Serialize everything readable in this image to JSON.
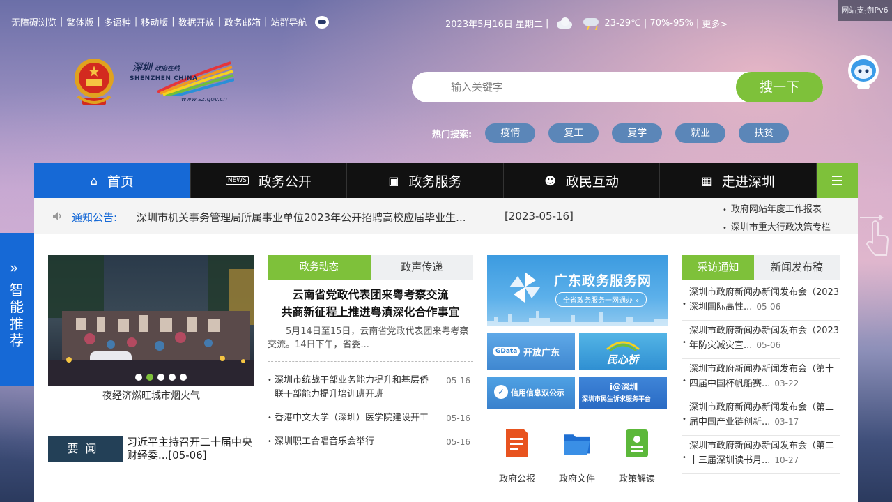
{
  "topbar": {
    "links": [
      "无障碍浏览",
      "繁体版",
      "多语种",
      "移动版",
      "数据开放",
      "政务邮箱",
      "站群导航"
    ],
    "date": "2023年5月16日 星期二",
    "weather": "23-29℃ | 70%-95%",
    "more": "更多>",
    "ipv6": "网站支持IPv6"
  },
  "logo": {
    "cn": "深圳",
    "cn_small": "政府在线",
    "en": "SHENZHEN CHINA",
    "url": "www.sz.gov.cn"
  },
  "search": {
    "placeholder": "输入关键字",
    "button": "搜一下",
    "hot_label": "热门搜索:",
    "hot_terms": [
      "疫情",
      "复工",
      "复学",
      "就业",
      "扶贫"
    ]
  },
  "nav": {
    "items": [
      "首页",
      "政务公开",
      "政务服务",
      "政民互动",
      "走进深圳"
    ]
  },
  "notice": {
    "label": "通知公告:",
    "text": "深圳市机关事务管理局所属事业单位2023年公开招聘高校应届毕业生...",
    "date": "[2023-05-16]",
    "quick_links": [
      "政府网站年度工作报表",
      "深圳市重大行政决策专栏"
    ]
  },
  "side": {
    "recommend": "智能推荐"
  },
  "carousel": {
    "caption": "夜经济燃旺城市烟火气",
    "active_index": 1
  },
  "important": {
    "tag": "要闻",
    "text": "习近平主持召开二十届中央财经委...[05-06]"
  },
  "news": {
    "tabs": [
      "政务动态",
      "政声传递"
    ],
    "headline_line1": "云南省党政代表团来粤考察交流",
    "headline_line2": "共商新征程上推进粤滇深化合作事宜",
    "summary": "5月14日至15日，云南省党政代表团来粤考察交流。14日下午，省委...",
    "items": [
      {
        "title": "深圳市统战干部业务能力提升和基层侨联干部能力提升培训班开班",
        "date": "05-16"
      },
      {
        "title": "香港中文大学（深圳）医学院建设开工",
        "date": "05-16"
      },
      {
        "title": "深圳职工合唱音乐会举行",
        "date": "05-16"
      }
    ]
  },
  "services": {
    "banner_title": "广东政务服务网",
    "banner_sub": "全省政务服务一网通办 »",
    "tiles": [
      "开放广东",
      "民心桥",
      "信用信息双公示",
      "深圳市民生诉求服务平台"
    ],
    "tile4_top": "i@深圳",
    "tile1_badge": "GData",
    "icons": [
      "政府公报",
      "政府文件",
      "政策解读"
    ]
  },
  "press": {
    "tabs": [
      "采访通知",
      "新闻发布稿"
    ],
    "items": [
      {
        "title": "深圳市政府新闻办新闻发布会（2023深圳国际高性...",
        "date": "05-06"
      },
      {
        "title": "深圳市政府新闻办新闻发布会（2023年防灾减灾宣...",
        "date": "05-06"
      },
      {
        "title": "深圳市政府新闻办新闻发布会（第十四届中国杯帆船赛...",
        "date": "03-22"
      },
      {
        "title": "深圳市政府新闻办新闻发布会（第二届中国产业链创新...",
        "date": "03-17"
      },
      {
        "title": "深圳市政府新闻办新闻发布会（第二十三届深圳读书月...",
        "date": "10-27"
      }
    ]
  },
  "colors": {
    "primary_blue": "#1669d6",
    "accent_green": "#7ec13a",
    "nav_black": "#111111"
  }
}
